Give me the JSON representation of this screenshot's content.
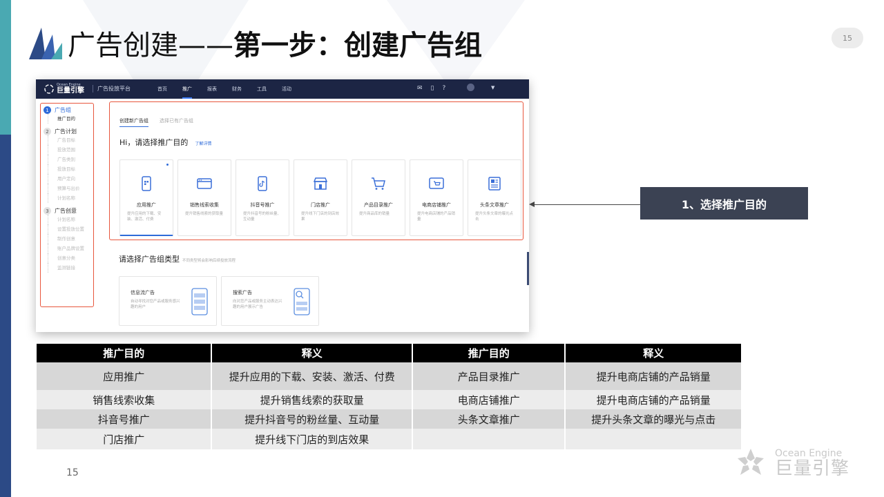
{
  "slide": {
    "title_normal": "广告创建——",
    "title_bold": "第一步：创建广告组",
    "page_badge": "15",
    "page_number": "15",
    "accent_teal": "#4aa9b2",
    "accent_navy": "#2c4a86"
  },
  "app": {
    "brand_en": "Ocean Engine",
    "brand_cn": "巨量引擎",
    "platform": "广告投放平台",
    "nav": [
      "首页",
      "推广",
      "报表",
      "财务",
      "工具",
      "活动"
    ],
    "nav_active": "推广",
    "icons": [
      "mail-icon",
      "phone-icon",
      "help-icon"
    ]
  },
  "steps": {
    "groups": [
      {
        "num": "1",
        "label": "广告组",
        "active": true,
        "subs": [
          "推广目的"
        ]
      },
      {
        "num": "2",
        "label": "广告计划",
        "active": false,
        "subs": [
          "广告目标",
          "投放范围",
          "广告类别",
          "投放目标",
          "用户定向",
          "预算与出价",
          "计划名称"
        ]
      },
      {
        "num": "3",
        "label": "广告创意",
        "active": false,
        "subs": [
          "计划名称",
          "设置投放位置",
          "制作创意",
          "账户品牌设置",
          "创意分类",
          "监测链接"
        ]
      }
    ]
  },
  "purpose": {
    "tabs": [
      "创建新广告组",
      "选择已有广告组"
    ],
    "greeting": "Hi，请选择推广目的",
    "more_link": "了解详情",
    "cards": [
      {
        "title": "应用推广",
        "desc": "提升应用的下载、安装、激活、付费",
        "icon": "mobile-app-icon"
      },
      {
        "title": "销售线索收集",
        "desc": "提升销售线索的获取量",
        "icon": "browser-window-icon"
      },
      {
        "title": "抖音号推广",
        "desc": "提升抖音号的粉丝量、互动量",
        "icon": "douyin-phone-icon"
      },
      {
        "title": "门店推广",
        "desc": "提升线下门店的到店效果",
        "icon": "storefront-icon"
      },
      {
        "title": "产品目录推广",
        "desc": "提升商品库的销量",
        "icon": "shopping-cart-icon"
      },
      {
        "title": "电商店铺推广",
        "desc": "提升电商店铺的产品销量",
        "icon": "shop-cart-screen-icon"
      },
      {
        "title": "头条文章推广",
        "desc": "提升头条文章的曝光点击",
        "icon": "article-icon"
      }
    ]
  },
  "ad_type": {
    "title": "请选择广告组类型",
    "hint": "不同类型将会影响后续投放流程",
    "cards": [
      {
        "title": "信息流广告",
        "desc": "自动寻找对您产品或服务感兴趣的用户"
      },
      {
        "title": "搜索广告",
        "desc": "向对您产品或服务主动表达兴趣的用户展示广告"
      }
    ]
  },
  "callout": {
    "text": "1、选择推广目的"
  },
  "table": {
    "headers": [
      "推广目的",
      "释义",
      "推广目的",
      "释义"
    ],
    "rows": [
      [
        "应用推广",
        "提升应用的下载、安装、激活、付费",
        "产品目录推广",
        "提升电商店铺的产品销量"
      ],
      [
        "销售线索收集",
        "提升销售线索的获取量",
        "电商店铺推广",
        "提升电商店铺的产品销量"
      ],
      [
        "抖音号推广",
        "提升抖音号的粉丝量、互动量",
        "头条文章推广",
        "提升头条文章的曝光与点击"
      ],
      [
        "门店推广",
        "提升线下门店的到店效果",
        "",
        ""
      ]
    ]
  },
  "footer_logo": {
    "en": "Ocean Engine",
    "cn": "巨量引擎"
  }
}
